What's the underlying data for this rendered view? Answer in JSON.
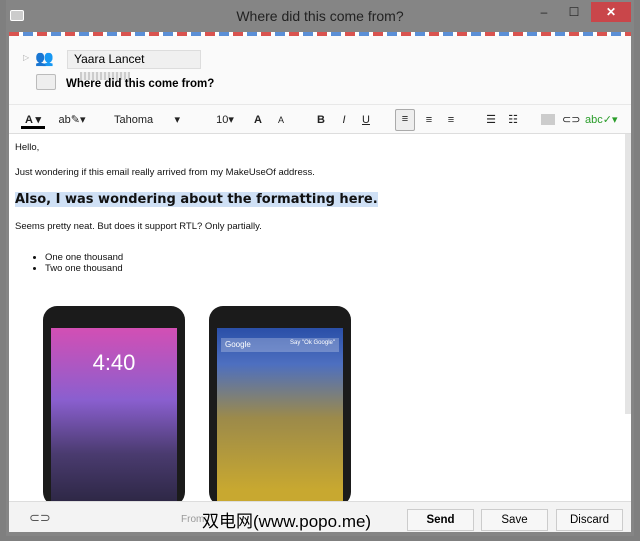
{
  "window": {
    "title": "Where did this come from?",
    "minimize": "–",
    "maximize": "☐",
    "close": "✕"
  },
  "header": {
    "recipient": "Yaara Lancet",
    "subject": "Where did this come from?"
  },
  "toolbar": {
    "font": "Tahoma",
    "size": "10",
    "bold": "B",
    "italic": "I",
    "underline": "U"
  },
  "body": {
    "greeting": "Hello,",
    "line1": "Just wondering if this email really arrived from my MakeUseOf address.",
    "highlight": "Also, I was wondering about the formatting here.",
    "line2": "Seems pretty neat. But does it support RTL? Only partially.",
    "list": [
      "One one thousand",
      "Two one thousand"
    ],
    "phone1_time": "4:40",
    "phone2_search": "Google",
    "phone2_hint": "Say \"Ok Google\""
  },
  "footer": {
    "from_label": "From:",
    "send": "Send",
    "save": "Save",
    "discard": "Discard",
    "watermark": "双电网(www.popo.me)"
  }
}
